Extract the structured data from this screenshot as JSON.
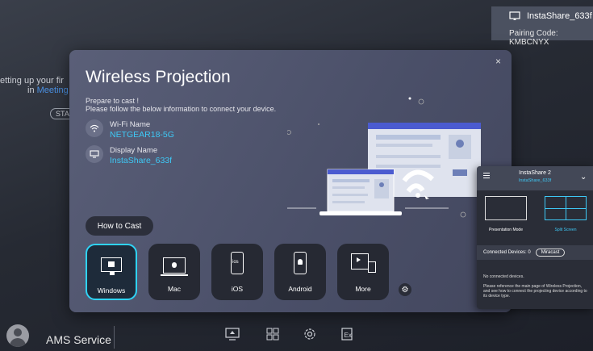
{
  "background": {
    "hint_line1": "etting up your fir",
    "hint_line2_prefix": "in ",
    "hint_line2_highlight": "Meeting",
    "start_button": "STA"
  },
  "badge": {
    "device_name": "InstaShare_633f",
    "pairing_code": "Pairing Code: KMBCNYX"
  },
  "dialog": {
    "title": "Wireless Projection",
    "close": "×",
    "prepare_line1": "Prepare to cast !",
    "prepare_line2": "Please follow the below information to connect your device.",
    "wifi_label": "Wi-Fi Name",
    "wifi_value": "NETGEAR18-5G",
    "display_label": "Display Name",
    "display_value": "InstaShare_633f",
    "how_to_cast": "How to Cast",
    "os_buttons": [
      {
        "label": "Windows",
        "icon": "windows-monitor-icon",
        "selected": true
      },
      {
        "label": "Mac",
        "icon": "mac-monitor-icon",
        "selected": false
      },
      {
        "label": "iOS",
        "icon": "ios-phone-icon",
        "selected": false
      },
      {
        "label": "Android",
        "icon": "android-phone-icon",
        "selected": false
      },
      {
        "label": "More",
        "icon": "more-devices-icon",
        "selected": false
      }
    ]
  },
  "panel": {
    "title": "InstaShare 2",
    "subtitle": "InstaShare_633f",
    "mode_presentation": "Presentation Mode",
    "mode_split": "Split Screen",
    "connected": "Connected Devices: 0",
    "miracast": "Miracast",
    "no_devices": "No connected devices.",
    "help_text": "Please reference the main page of Wireless Projection, and see how to connect the projecting device according to its device type."
  },
  "bottom": {
    "user_name": "AMS Service"
  },
  "colors": {
    "accent": "#3ec8f5",
    "selected_border": "#2fd3f5"
  }
}
